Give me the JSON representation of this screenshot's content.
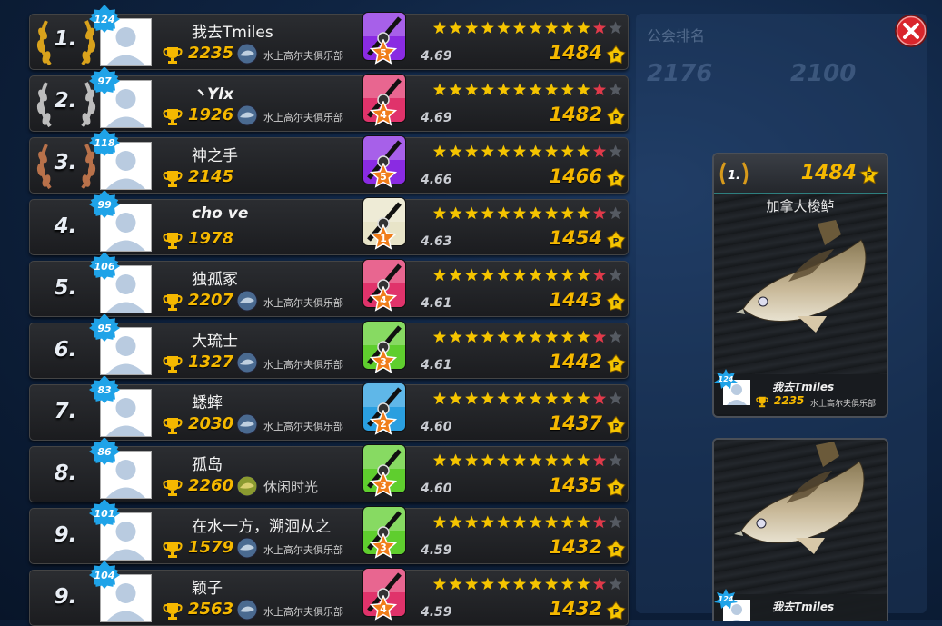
{
  "background": {
    "tab_label": "公会排名",
    "numbers": [
      "2176",
      "2100"
    ]
  },
  "close_button": {
    "icon": "close-icon",
    "color": "#d9262c"
  },
  "leaderboard": [
    {
      "rank": "1.",
      "level": "124",
      "name": "我去Tmiles",
      "score": "2235",
      "club": "水上高尔夫俱乐部",
      "rod_level": "5",
      "rod_color": "#8a2be2",
      "rating": "4.69",
      "points": "1484",
      "medal": "gold"
    },
    {
      "rank": "2.",
      "level": "97",
      "name": "丶Ylx",
      "score": "1926",
      "club": "水上高尔夫俱乐部",
      "rod_level": "4",
      "rod_color": "#e0336b",
      "rating": "4.69",
      "points": "1482",
      "medal": "silver"
    },
    {
      "rank": "3.",
      "level": "118",
      "name": "神之手",
      "score": "2145",
      "club": "",
      "rod_level": "5",
      "rod_color": "#8a2be2",
      "rating": "4.66",
      "points": "1466",
      "medal": "bronze"
    },
    {
      "rank": "4.",
      "level": "99",
      "name": "cho ve",
      "score": "1978",
      "club": "",
      "rod_level": "1",
      "rod_color": "#e8e4c8",
      "rating": "4.63",
      "points": "1454",
      "medal": ""
    },
    {
      "rank": "5.",
      "level": "106",
      "name": "独孤冢",
      "score": "2207",
      "club": "水上高尔夫俱乐部",
      "rod_level": "4",
      "rod_color": "#e0336b",
      "rating": "4.61",
      "points": "1443",
      "medal": ""
    },
    {
      "rank": "6.",
      "level": "95",
      "name": "大琉士",
      "score": "1327",
      "club": "水上高尔夫俱乐部",
      "rod_level": "3",
      "rod_color": "#5fce2e",
      "rating": "4.61",
      "points": "1442",
      "medal": ""
    },
    {
      "rank": "7.",
      "level": "83",
      "name": "蟋蟀",
      "score": "2030",
      "club": "水上高尔夫俱乐部",
      "rod_level": "2",
      "rod_color": "#2a9fe0",
      "rating": "4.60",
      "points": "1437",
      "medal": ""
    },
    {
      "rank": "8.",
      "level": "86",
      "name": "孤岛",
      "score": "2260",
      "club": "休闲时光",
      "rod_level": "3",
      "rod_color": "#5fce2e",
      "rating": "4.60",
      "points": "1435",
      "medal": ""
    },
    {
      "rank": "9.",
      "level": "101",
      "name": "在水一方，溯洄从之",
      "score": "1579",
      "club": "水上高尔夫俱乐部",
      "rod_level": "3",
      "rod_color": "#5fce2e",
      "rating": "4.59",
      "points": "1432",
      "medal": ""
    },
    {
      "rank": "9.",
      "level": "104",
      "name": "颖子",
      "score": "2563",
      "club": "水上高尔夫俱乐部",
      "rod_level": "4",
      "rod_color": "#e0336b",
      "rating": "4.59",
      "points": "1432",
      "medal": ""
    }
  ],
  "star_rating": {
    "full_stars": 10,
    "total_stars": 12
  },
  "cards": [
    {
      "rank": "1.",
      "points": "1484",
      "fish_name": "加拿大梭鲈",
      "level": "124",
      "player": "我去Tmiles",
      "score": "2235",
      "club": "水上高尔夫俱乐部"
    },
    {
      "level": "124",
      "player": "我去Tmiles"
    }
  ]
}
